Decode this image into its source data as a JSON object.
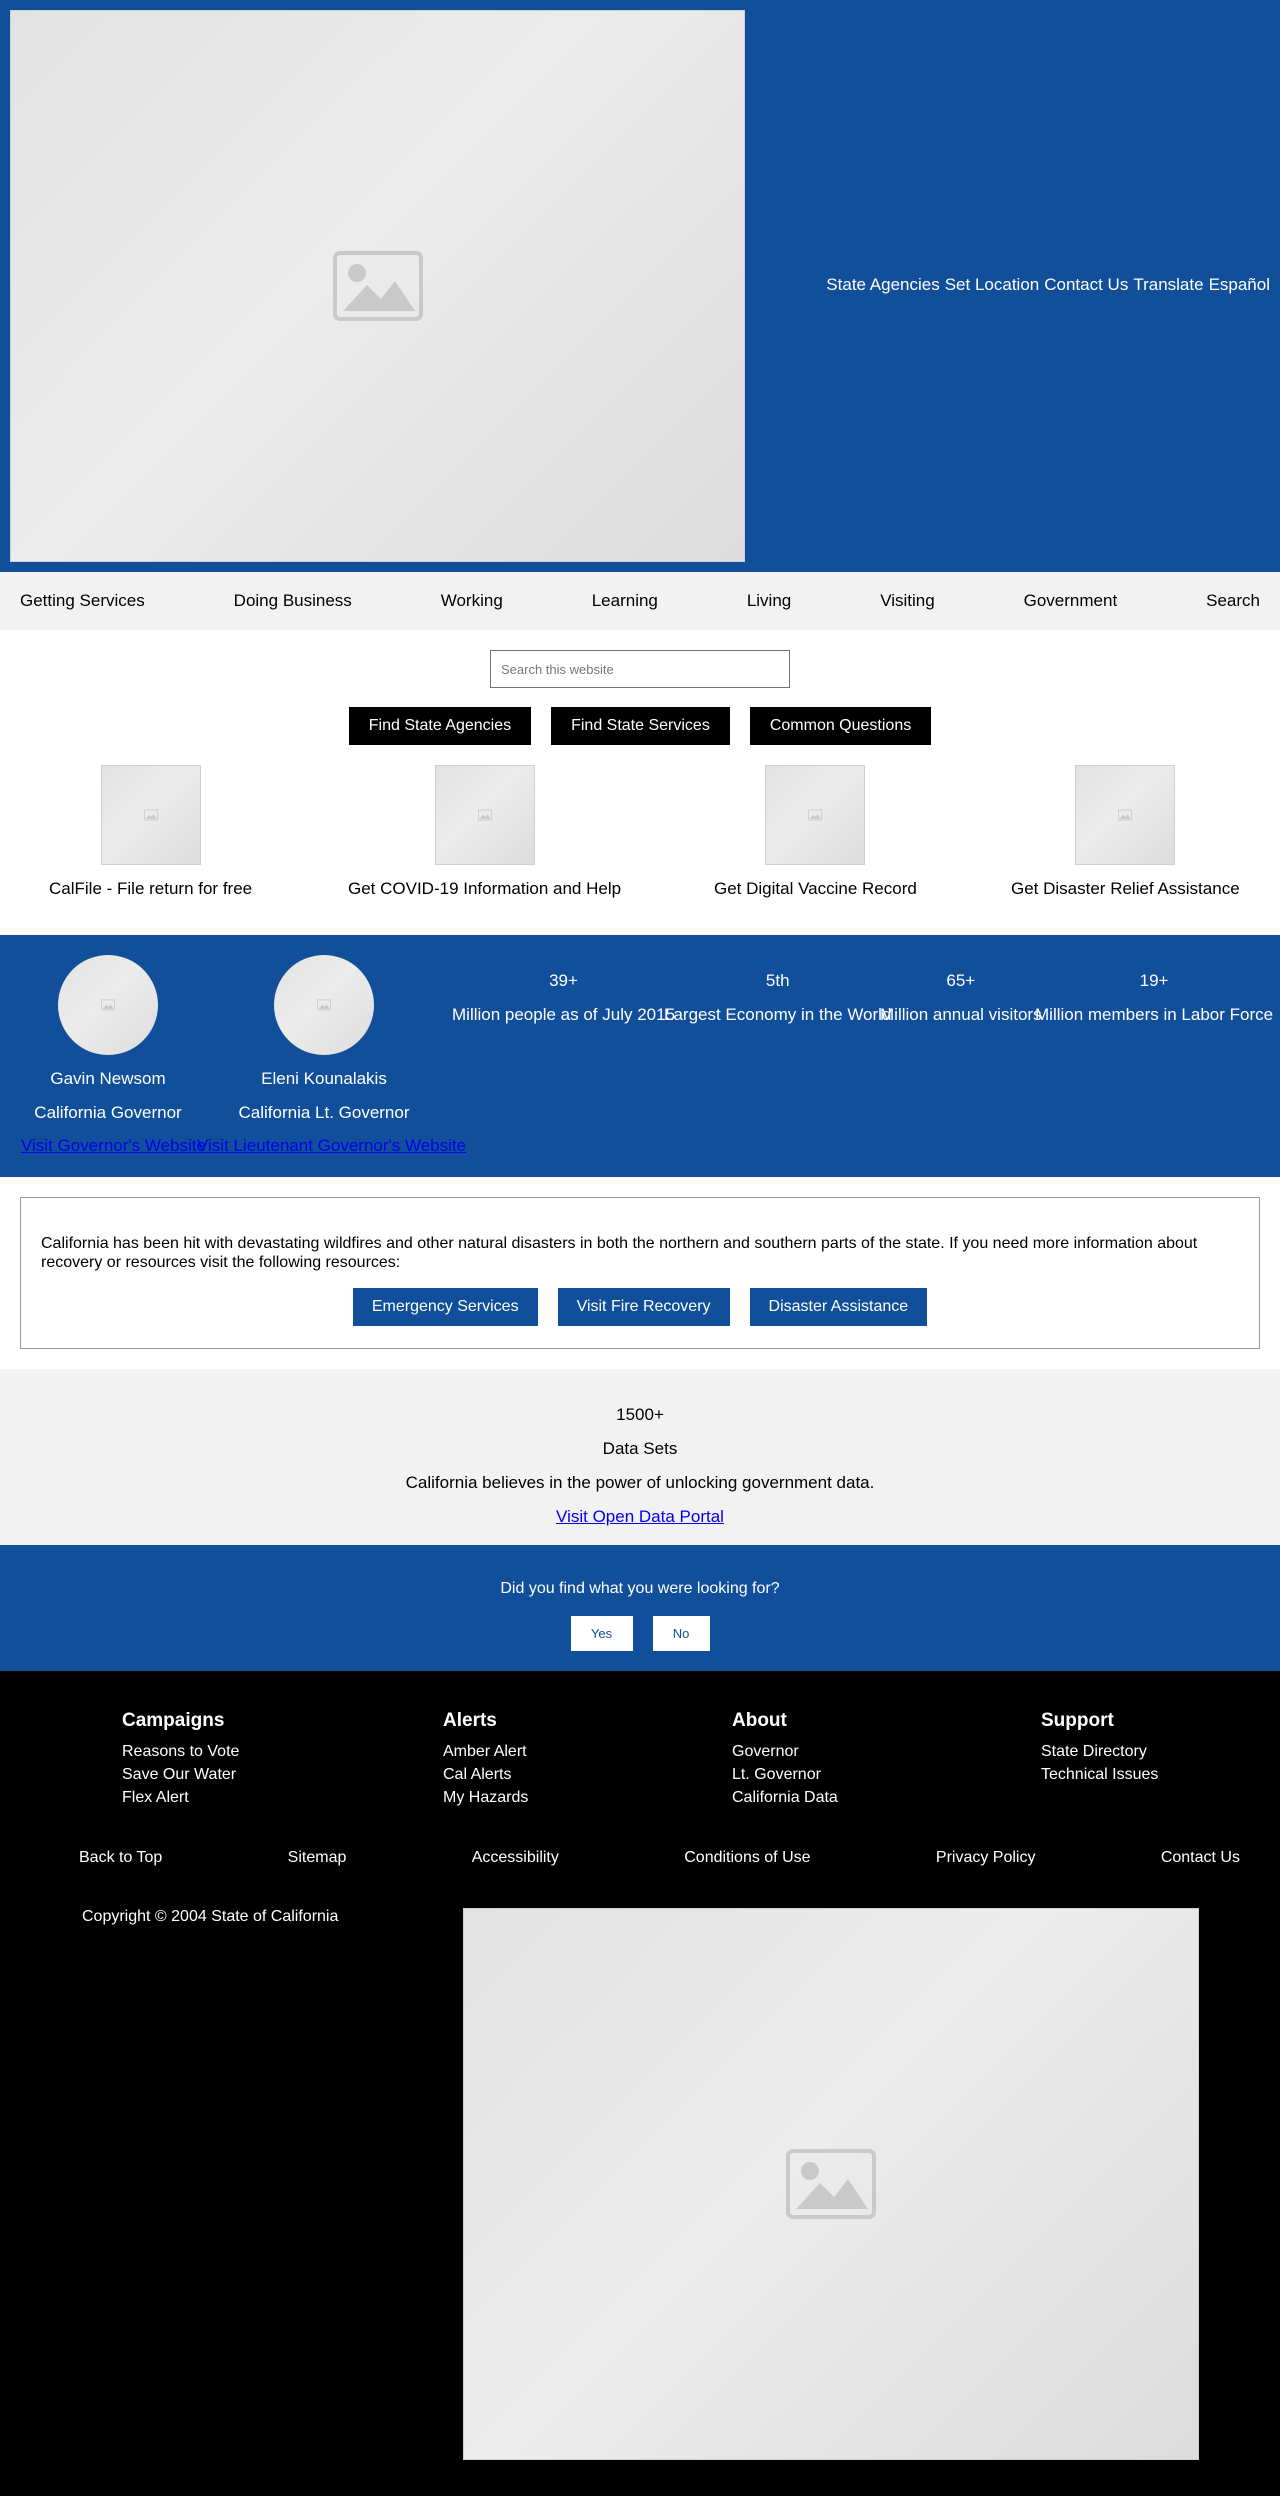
{
  "utility_nav": [
    "State Agencies",
    "Set Location",
    "Contact Us",
    "Translate",
    "Español"
  ],
  "main_nav": [
    "Getting Services",
    "Doing Business",
    "Working",
    "Learning",
    "Living",
    "Visiting",
    "Government",
    "Search"
  ],
  "search": {
    "placeholder": "Search this website"
  },
  "quick_buttons": [
    "Find State Agencies",
    "Find State Services",
    "Common Questions"
  ],
  "features": [
    {
      "label": "CalFile - File return for free"
    },
    {
      "label": "Get COVID-19 Information and Help"
    },
    {
      "label": "Get Digital Vaccine Record"
    },
    {
      "label": "Get Disaster Relief Assistance"
    }
  ],
  "leaders": [
    {
      "name": "Gavin Newsom",
      "role": "California Governor",
      "link": "Visit Governor's Website"
    },
    {
      "name": "Eleni Kounalakis",
      "role": "California Lt. Governor",
      "link": "Visit Lieutenant Governor's Website"
    }
  ],
  "stats": [
    {
      "value": "39+",
      "desc": "Million people as of July 2015"
    },
    {
      "value": "5th",
      "desc": "Largest Economy in the World"
    },
    {
      "value": "65+",
      "desc": "Million annual visitors"
    },
    {
      "value": "19+",
      "desc": "Million members in Labor Force"
    }
  ],
  "alert": {
    "text": "California has been hit with devastating wildfires and other natural disasters in both the northern and southern parts of the state. If you need more information about recovery or resources visit the following resources:",
    "buttons": [
      "Emergency Services",
      "Visit Fire Recovery",
      "Disaster Assistance"
    ]
  },
  "data_section": {
    "count": "1500+",
    "label": "Data Sets",
    "description": "California believes in the power of unlocking government data.",
    "link": "Visit Open Data Portal"
  },
  "feedback": {
    "question": "Did you find what you were looking for?",
    "yes": "Yes",
    "no": "No"
  },
  "footer": {
    "columns": [
      {
        "title": "Campaigns",
        "items": [
          "Reasons to Vote",
          "Save Our Water",
          "Flex Alert"
        ]
      },
      {
        "title": "Alerts",
        "items": [
          "Amber Alert",
          "Cal Alerts",
          "My Hazards"
        ]
      },
      {
        "title": "About",
        "items": [
          "Governor",
          "Lt. Governor",
          "California Data"
        ]
      },
      {
        "title": "Support",
        "items": [
          "State Directory",
          "Technical Issues"
        ]
      }
    ],
    "links": [
      "Back to Top",
      "Sitemap",
      "Accessibility",
      "Conditions of Use",
      "Privacy Policy",
      "Contact Us"
    ],
    "copyright": "Copyright © 2004 State of California"
  },
  "colors": {
    "brand_blue": "#114f9a",
    "nav_bg": "#f2f2f2",
    "footer_bg": "#000000",
    "link": "#0000ee"
  },
  "icons": {
    "placeholder_image": "image-placeholder-icon"
  }
}
